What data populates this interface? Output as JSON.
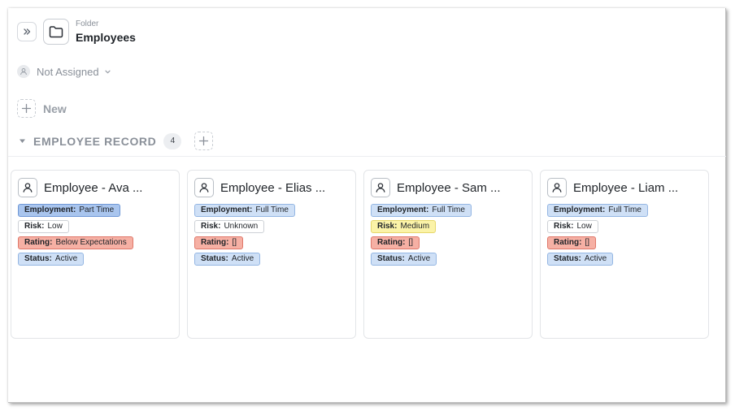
{
  "header": {
    "expand_icon": "chevrons-right-icon",
    "folder_icon": "folder-icon",
    "kind": "Folder",
    "name": "Employees"
  },
  "assignee": {
    "icon": "person-icon",
    "label": "Not Assigned",
    "dropdown_icon": "chevron-down-icon"
  },
  "new_item": {
    "icon": "plus-icon",
    "label": "New"
  },
  "section": {
    "title": "EMPLOYEE RECORD",
    "count": "4",
    "collapse_icon": "caret-down-icon",
    "add_icon": "plus-icon"
  },
  "cards": [
    {
      "title": "Employee - Ava ...",
      "tags": [
        {
          "key": "Employment:",
          "value": "Part Time",
          "color": "blue-strong"
        },
        {
          "key": "Risk:",
          "value": "Low",
          "color": "white"
        },
        {
          "key": "Rating:",
          "value": "Below Expectations",
          "color": "red"
        },
        {
          "key": "Status:",
          "value": "Active",
          "color": "blue"
        }
      ]
    },
    {
      "title": "Employee - Elias ...",
      "tags": [
        {
          "key": "Employment:",
          "value": "Full Time",
          "color": "blue"
        },
        {
          "key": "Risk:",
          "value": "Unknown",
          "color": "white"
        },
        {
          "key": "Rating:",
          "value": "[]",
          "color": "red"
        },
        {
          "key": "Status:",
          "value": "Active",
          "color": "blue"
        }
      ]
    },
    {
      "title": "Employee - Sam ...",
      "tags": [
        {
          "key": "Employment:",
          "value": "Full Time",
          "color": "blue"
        },
        {
          "key": "Risk:",
          "value": "Medium",
          "color": "yellow"
        },
        {
          "key": "Rating:",
          "value": "[]",
          "color": "red"
        },
        {
          "key": "Status:",
          "value": "Active",
          "color": "blue"
        }
      ]
    },
    {
      "title": "Employee - Liam ...",
      "tags": [
        {
          "key": "Employment:",
          "value": "Full Time",
          "color": "blue"
        },
        {
          "key": "Risk:",
          "value": "Low",
          "color": "white"
        },
        {
          "key": "Rating:",
          "value": "[]",
          "color": "red"
        },
        {
          "key": "Status:",
          "value": "Active",
          "color": "blue"
        }
      ]
    }
  ],
  "colors": {
    "tag_blue": "#cfe0f6",
    "tag_blue_strong": "#a9c5ee",
    "tag_red": "#f6b0a4",
    "tag_yellow": "#fbf3a8",
    "tag_white": "#ffffff"
  }
}
